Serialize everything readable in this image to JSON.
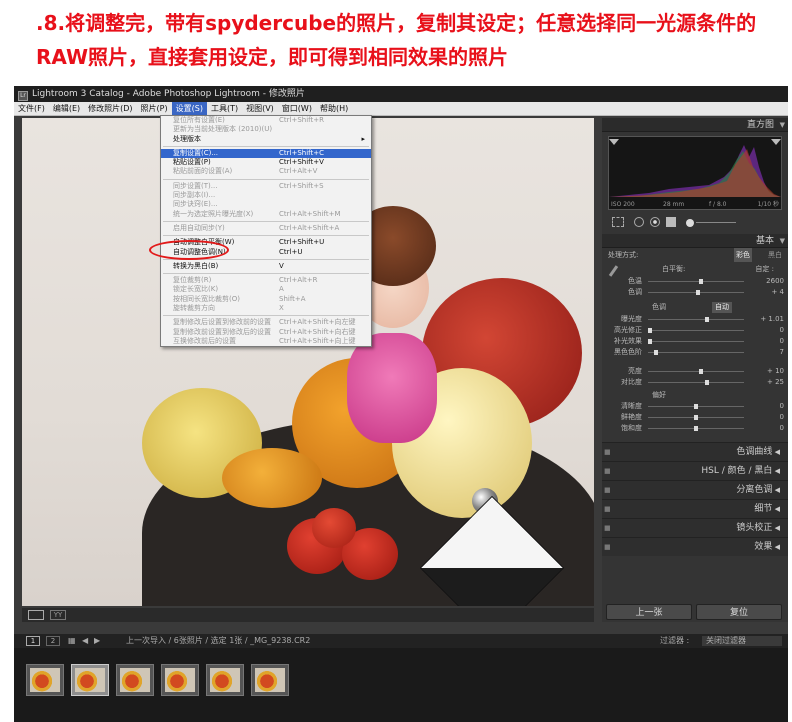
{
  "caption": {
    "line1": ".8.将调整完，带有spydercube的照片，复制其设定；任意选择同一光源条件的",
    "line2": "RAW照片，直接套用设定，即可得到相同效果的照片"
  },
  "window": {
    "icon": "Lr",
    "title": "Lightroom 3 Catalog - Adobe Photoshop Lightroom - 修改照片"
  },
  "menubar": [
    "文件(F)",
    "编辑(E)",
    "修改照片(D)",
    "照片(P)",
    "设置(S)",
    "工具(T)",
    "视图(V)",
    "窗口(W)",
    "帮助(H)"
  ],
  "dropdown": {
    "groups": [
      [
        {
          "label": "复位所有设置(E)",
          "shortcut": "Ctrl+Shift+R",
          "disabled": true
        },
        {
          "label": "更新为当前处理版本 (2010)(U)",
          "shortcut": "",
          "disabled": true
        },
        {
          "label": "处理版本",
          "shortcut": "",
          "disabled": false,
          "submenu": true
        }
      ],
      [
        {
          "label": "复制设置(C)...",
          "shortcut": "Ctrl+Shift+C",
          "disabled": false,
          "highlight": true
        },
        {
          "label": "粘贴设置(P)",
          "shortcut": "Ctrl+Shift+V",
          "disabled": false
        },
        {
          "label": "粘贴前面的设置(A)",
          "shortcut": "Ctrl+Alt+V",
          "disabled": true
        }
      ],
      [
        {
          "label": "同步设置(T)...",
          "shortcut": "Ctrl+Shift+S",
          "disabled": true
        },
        {
          "label": "同步副本(I)...",
          "shortcut": "",
          "disabled": true
        },
        {
          "label": "同步诀窍(E)...",
          "shortcut": "",
          "disabled": true
        },
        {
          "label": "统一为选定照片曝光度(X)",
          "shortcut": "Ctrl+Alt+Shift+M",
          "disabled": true
        }
      ],
      [
        {
          "label": "启用自动同步(Y)",
          "shortcut": "Ctrl+Alt+Shift+A",
          "disabled": true
        }
      ],
      [
        {
          "label": "自动调整白平衡(W)",
          "shortcut": "Ctrl+Shift+U",
          "disabled": false
        },
        {
          "label": "自动调整色调(N)",
          "shortcut": "Ctrl+U",
          "disabled": false
        }
      ],
      [
        {
          "label": "转换为黑白(B)",
          "shortcut": "V",
          "disabled": false
        }
      ],
      [
        {
          "label": "复位裁剪(R)",
          "shortcut": "Ctrl+Alt+R",
          "disabled": true
        },
        {
          "label": "锁定长宽比(K)",
          "shortcut": "A",
          "disabled": true
        },
        {
          "label": "按相同长宽比裁剪(O)",
          "shortcut": "Shift+A",
          "disabled": true
        },
        {
          "label": "旋转裁剪方向",
          "shortcut": "X",
          "disabled": true
        }
      ],
      [
        {
          "label": "复制修改后设置到修改前的设置",
          "shortcut": "Ctrl+Alt+Shift+向左键",
          "disabled": true
        },
        {
          "label": "复制修改前设置到修改后的设置",
          "shortcut": "Ctrl+Alt+Shift+向右键",
          "disabled": true
        },
        {
          "label": "互换修改前后的设置",
          "shortcut": "Ctrl+Alt+Shift+向上键",
          "disabled": true
        }
      ]
    ]
  },
  "right_panel": {
    "histogram_title": "直方图",
    "histogram_info": {
      "iso": "ISO 200",
      "focal": "28 mm",
      "aperture": "f / 8.0",
      "shutter": "1/10 秒"
    },
    "basic_title": "基本",
    "treatment_label": "处理方式:",
    "treatment_color": "彩色",
    "treatment_bw": "黑白",
    "wb_label": "白平衡:",
    "wb_value": "自定 :",
    "temp": {
      "label": "色温",
      "value": "2600",
      "pos": 0.55
    },
    "tint": {
      "label": "色调",
      "value": "+ 4",
      "pos": 0.52
    },
    "tone_label": "色调",
    "tone_auto": "自动",
    "tone_rows": [
      {
        "label": "曝光度",
        "value": "+ 1.01",
        "pos": 0.62
      },
      {
        "label": "高光修正",
        "value": "0",
        "pos": 0.0
      },
      {
        "label": "补光效果",
        "value": "0",
        "pos": 0.0
      },
      {
        "label": "黑色色阶",
        "value": "7",
        "pos": 0.07
      }
    ],
    "presence_rows": [
      {
        "label": "亮度",
        "value": "+ 10",
        "pos": 0.55
      },
      {
        "label": "对比度",
        "value": "+ 25",
        "pos": 0.62
      }
    ],
    "presence_label": "偏好",
    "clarity_rows": [
      {
        "label": "清晰度",
        "value": "0",
        "pos": 0.5
      },
      {
        "label": "鲜艳度",
        "value": "0",
        "pos": 0.5
      },
      {
        "label": "饱和度",
        "value": "0",
        "pos": 0.5
      }
    ],
    "sections": [
      "色调曲线",
      "HSL / 颜色 / 黑白",
      "分离色调",
      "细节",
      "镜头校正",
      "效果"
    ],
    "prev_button": "上一张",
    "reset_button": "复位"
  },
  "filmstrip_nav": {
    "page1": "1",
    "page2": "2",
    "info": "上一次导入 / 6张照片 / 选定 1张 / _MG_9238.CR2",
    "filter_label": "过滤器 :",
    "filter_value": "关闭过滤器"
  },
  "thumbnails": 6
}
